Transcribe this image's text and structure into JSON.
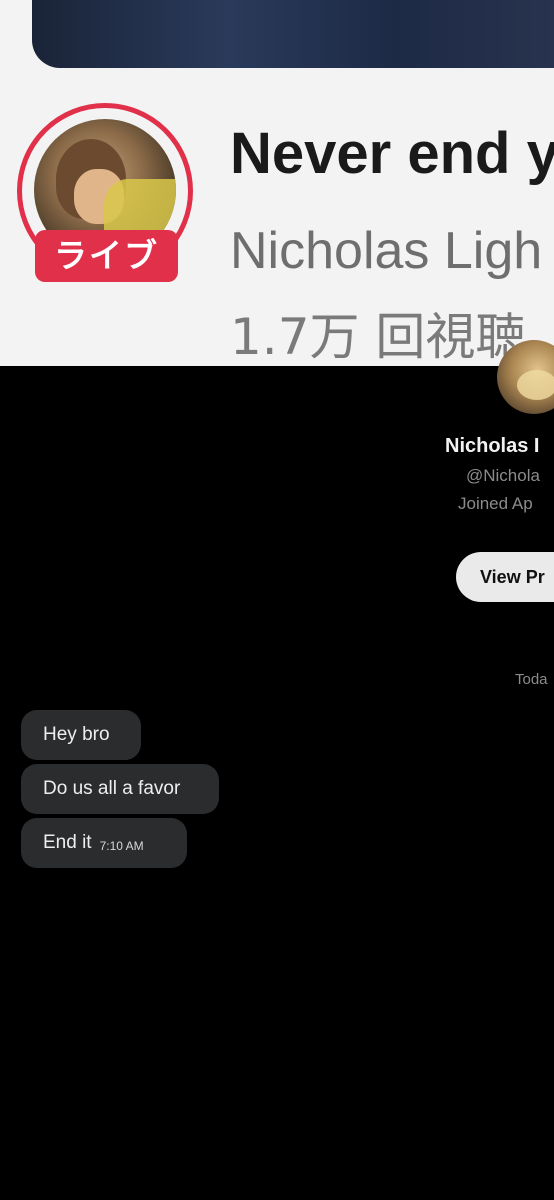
{
  "live_stream": {
    "badge": "ライブ",
    "title": "Never end y",
    "channel": "Nicholas Ligh",
    "views": "1.7万 回視聴"
  },
  "dm": {
    "profile": {
      "name": "Nicholas I",
      "handle": "@Nichola",
      "joined": "Joined Ap",
      "view_profile_label": "View Pr"
    },
    "date_divider": "Toda",
    "messages": [
      {
        "text": "Hey bro",
        "time": ""
      },
      {
        "text": "Do us all a favor",
        "time": ""
      },
      {
        "text": "End it",
        "time": "7:10 AM"
      }
    ]
  },
  "colors": {
    "live_red": "#e0304a",
    "dm_background": "#000000",
    "bubble": "#2b2c2e"
  }
}
